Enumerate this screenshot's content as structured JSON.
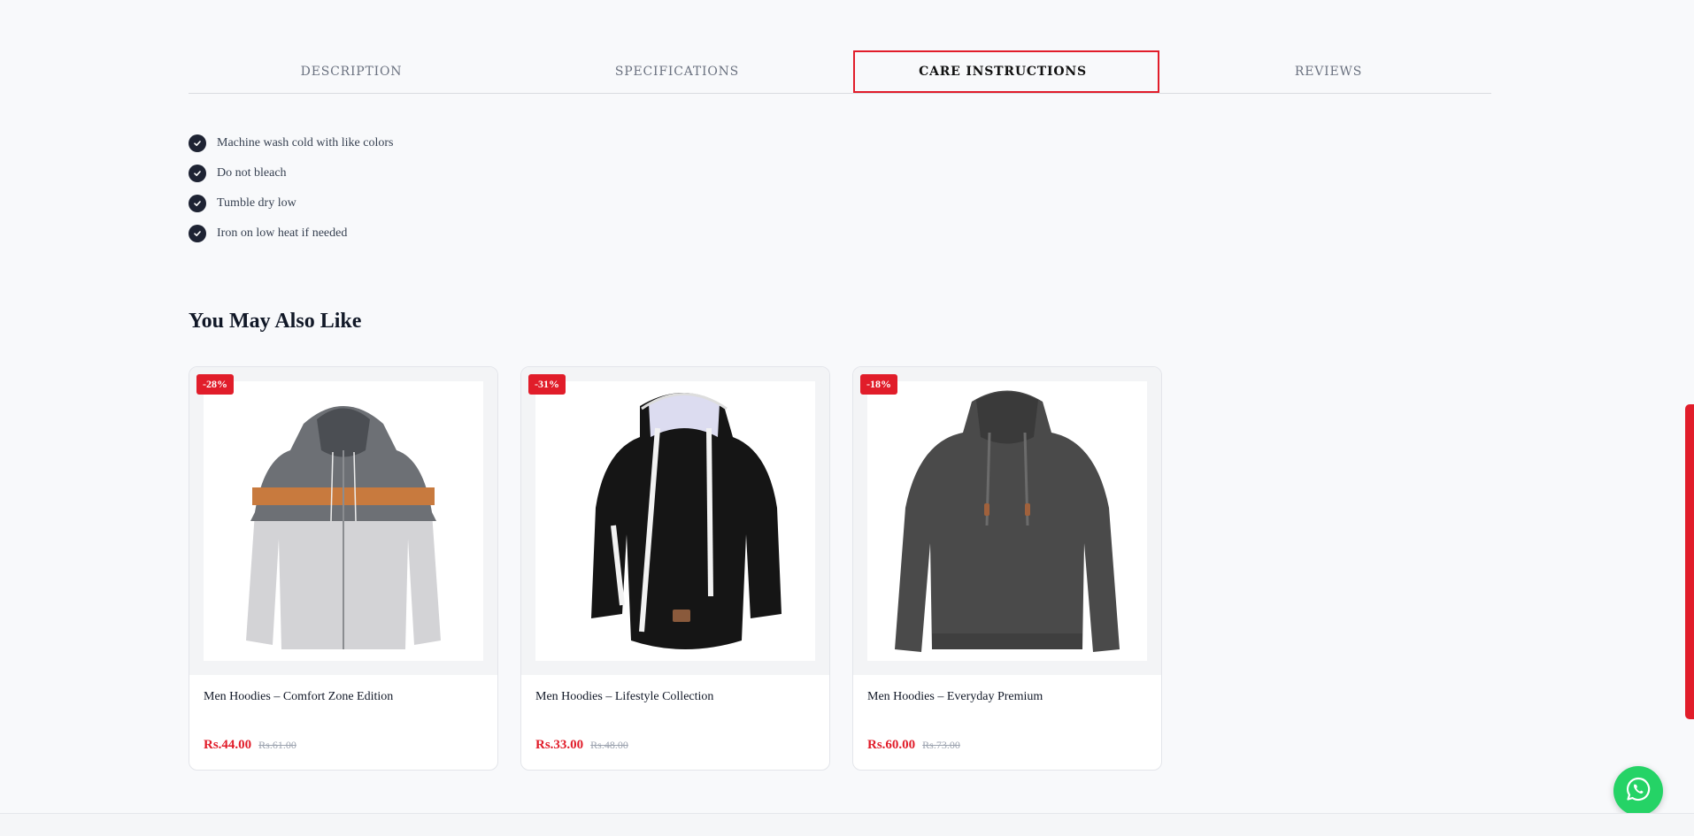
{
  "tabs": [
    {
      "label": "DESCRIPTION"
    },
    {
      "label": "SPECIFICATIONS"
    },
    {
      "label": "CARE INSTRUCTIONS"
    },
    {
      "label": "REVIEWS"
    }
  ],
  "active_tab": "CARE INSTRUCTIONS",
  "care_instructions": [
    "Machine wash cold with like colors",
    "Do not bleach",
    "Tumble dry low",
    "Iron on low heat if needed"
  ],
  "related": {
    "title": "You May Also Like",
    "products": [
      {
        "badge": "-28%",
        "name": "Men Hoodies – Comfort Zone Edition",
        "price": "Rs.44.00",
        "old_price": "Rs.61.00",
        "image": "grey-orange-zip-hoodie"
      },
      {
        "badge": "-31%",
        "name": "Men Hoodies – Lifestyle Collection",
        "price": "Rs.33.00",
        "old_price": "Rs.48.00",
        "image": "black-hoodie-white-drawstrings"
      },
      {
        "badge": "-18%",
        "name": "Men Hoodies – Everyday Premium",
        "price": "Rs.60.00",
        "old_price": "Rs.73.00",
        "image": "dark-grey-textured-hoodie"
      }
    ]
  },
  "colors": {
    "accent": "#e11d2a",
    "whatsapp": "#25d366",
    "check_bg": "#1e2333"
  },
  "icons": {
    "check": "check-icon",
    "whatsapp": "whatsapp-icon"
  }
}
